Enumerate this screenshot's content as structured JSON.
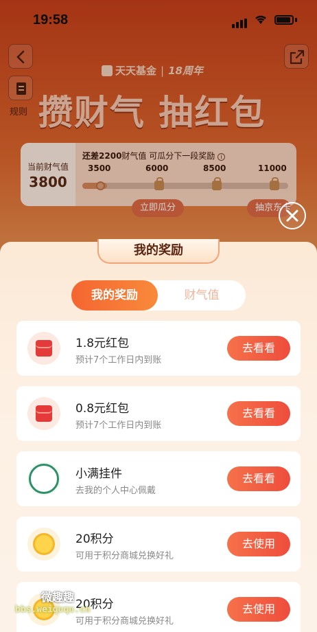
{
  "status_bar": {
    "time": "19:58"
  },
  "header": {
    "rules_label": "规则",
    "brand_name": "天天基金",
    "brand_sub": "18周年",
    "headline": "攒财气 抽红包"
  },
  "energy": {
    "current_label": "当前财气值",
    "current_value": "3800",
    "hint_prefix": "还差",
    "hint_amount": "2200",
    "hint_suffix": "财气值 可瓜分下一段奖励",
    "milestones": [
      "3500",
      "6000",
      "8500",
      "11000"
    ],
    "progress": 0.12,
    "button_divide": "立即瓜分",
    "button_draw": "抽京东卡"
  },
  "panel": {
    "title": "我的奖励",
    "tabs": [
      {
        "label": "我的奖励",
        "active": true
      },
      {
        "label": "财气值",
        "active": false
      }
    ],
    "rewards": [
      {
        "icon": "red-envelope-icon",
        "title": "1.8元红包",
        "desc": "预计7个工作日内到账",
        "action": "去看看"
      },
      {
        "icon": "red-envelope-icon",
        "title": "0.8元红包",
        "desc": "预计7个工作日内到账",
        "action": "去看看"
      },
      {
        "icon": "pendant-icon",
        "title": "小满挂件",
        "desc": "去我的个人中心佩戴",
        "action": "去看看"
      },
      {
        "icon": "points-coin-icon",
        "title": "20积分",
        "desc": "可用于积分商城兑换好礼",
        "action": "去使用"
      },
      {
        "icon": "points-coin-icon",
        "title": "20积分",
        "desc": "可用于积分商城兑换好礼",
        "action": "去使用"
      }
    ]
  },
  "watermark": {
    "line1": "微趣趣",
    "line2": "bbs.weiququ.cn"
  },
  "colors": {
    "accent": "#f56531",
    "action": "#ee4d3c",
    "envelope": "#e43a3a"
  }
}
